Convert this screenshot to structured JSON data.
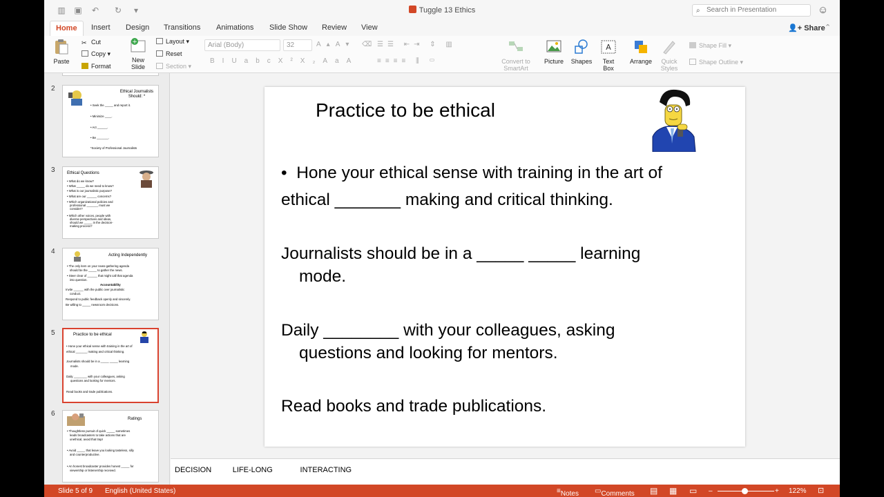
{
  "window": {
    "title": "Tuggle 13 Ethics",
    "search_placeholder": "Search in Presentation"
  },
  "tabs": [
    "Home",
    "Insert",
    "Design",
    "Transitions",
    "Animations",
    "Slide Show",
    "Review",
    "View"
  ],
  "share_label": "Share",
  "ribbon": {
    "paste": "Paste",
    "cut": "Cut",
    "copy": "Copy",
    "format": "Format",
    "new_slide": "New Slide",
    "layout": "Layout",
    "reset": "Reset",
    "section": "Section",
    "font_name": "Arial (Body)",
    "font_size": "32",
    "convert_smartart": "Convert to SmartArt",
    "picture": "Picture",
    "shapes": "Shapes",
    "text_box": "Text Box",
    "arrange": "Arrange",
    "quick_styles": "Quick Styles",
    "shape_fill": "Shape Fill",
    "shape_outline": "Shape Outline"
  },
  "thumbnails": [
    {
      "num": "2",
      "title": "Ethical Journalists Should: *",
      "lines": [
        "Seek the _____ and report it.",
        "Minimize ____.",
        "Act ______.",
        "Be _______.",
        "*Society of Professional Journalists"
      ]
    },
    {
      "num": "3",
      "title": "Ethical Questions",
      "lines": [
        "What do we know?",
        "What _____ do we need to know?",
        "What is our journalistic purpose?",
        "What are our ______ concerns?",
        "Which organizational policies and",
        "professional _______ must we",
        "consider?",
        "Which other voices, people with",
        "diverse perspectives and ideas,",
        "should we _____ in the decision-",
        "making process?"
      ]
    },
    {
      "num": "4",
      "title": "Acting Independently",
      "lines": [
        "The only item on your news-gathering agenda",
        "should be the _____ to gather the news.",
        "Steer clear of ______ that might call that agenda",
        "into question.",
        "Accountability",
        "Invite ______ with the public over journalistic",
        "conduct.",
        "Respond to public feedback openly and sincerely.",
        "Be willing to _____ newsroom decisions."
      ]
    },
    {
      "num": "5",
      "title": "Practice to be ethical",
      "lines": [
        "Hone your ethical sense with training in the art of",
        "ethical _______ making and critical thinking.",
        "Journalists should be in a _____ _____ learning",
        "mode.",
        "Daily ________ with your colleagues, asking",
        "questions and looking for mentors.",
        "Read books and trade publications."
      ]
    },
    {
      "num": "6",
      "title": "Ratings",
      "lines": [
        "Thoughtless pursuit of quick _____ sometimes",
        "leads broadcasters to take actions that are",
        "unethical, avoid that trap!",
        "Avoid _____ that leave you looking tasteless, silly",
        "and counterproductive.",
        "An honest broadcaster provides honest _____ for",
        "viewership or listenership received."
      ]
    }
  ],
  "slide": {
    "title": "Practice to be ethical",
    "bullet": "•",
    "line1": "Hone your ethical sense with training in the art of",
    "line2": "ethical _______  making and critical thinking.",
    "line3": "Journalists should be in a _____ _____ learning",
    "line4": "mode.",
    "line5": "Daily ________ with your colleagues, asking",
    "line6": "questions and looking for mentors.",
    "line7": "Read books and trade publications."
  },
  "notes": {
    "text": "DECISION          LIFE-LONG             INTERACTING"
  },
  "status": {
    "slide_pos": "Slide 5 of 9",
    "language": "English (United States)",
    "notes": "Notes",
    "comments": "Comments",
    "zoom": "122%"
  },
  "colors": {
    "accent": "#d24726",
    "selection": "#d9412e"
  }
}
